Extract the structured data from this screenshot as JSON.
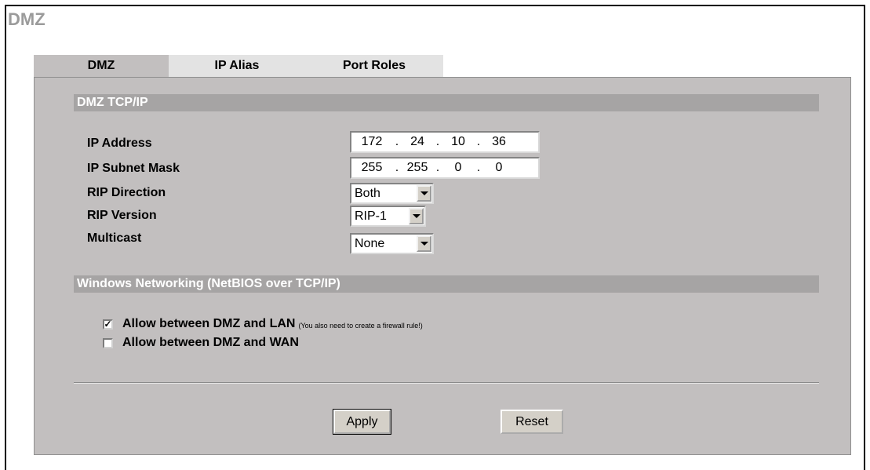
{
  "page": {
    "title": "DMZ"
  },
  "tabs": [
    {
      "label": "DMZ",
      "active": true
    },
    {
      "label": "IP Alias",
      "active": false
    },
    {
      "label": "Port Roles",
      "active": false
    }
  ],
  "tcpip": {
    "section_title": "DMZ TCP/IP",
    "ip_address": {
      "label": "IP Address",
      "octets": [
        "172",
        "24",
        "10",
        "36"
      ]
    },
    "subnet_mask": {
      "label": "IP Subnet Mask",
      "octets": [
        "255",
        "255",
        "0",
        "0"
      ]
    },
    "rip_direction": {
      "label": "RIP Direction",
      "value": "Both"
    },
    "rip_version": {
      "label": "RIP Version",
      "value": "RIP-1"
    },
    "multicast": {
      "label": "Multicast",
      "value": "None"
    }
  },
  "netbios": {
    "section_title": "Windows Networking (NetBIOS over TCP/IP)",
    "allow_lan": {
      "label": "Allow between DMZ and LAN",
      "note": "(You also need to create a firewall rule!)",
      "checked": true,
      "mark": "✓"
    },
    "allow_wan": {
      "label": "Allow between DMZ and WAN",
      "checked": false,
      "mark": ""
    }
  },
  "buttons": {
    "apply": "Apply",
    "reset": "Reset"
  },
  "colors": {
    "panel": "#c2bfbf",
    "section_bar": "#a6a4a4",
    "tab_inactive": "#e3e3e3",
    "title": "#9b9b9b"
  }
}
